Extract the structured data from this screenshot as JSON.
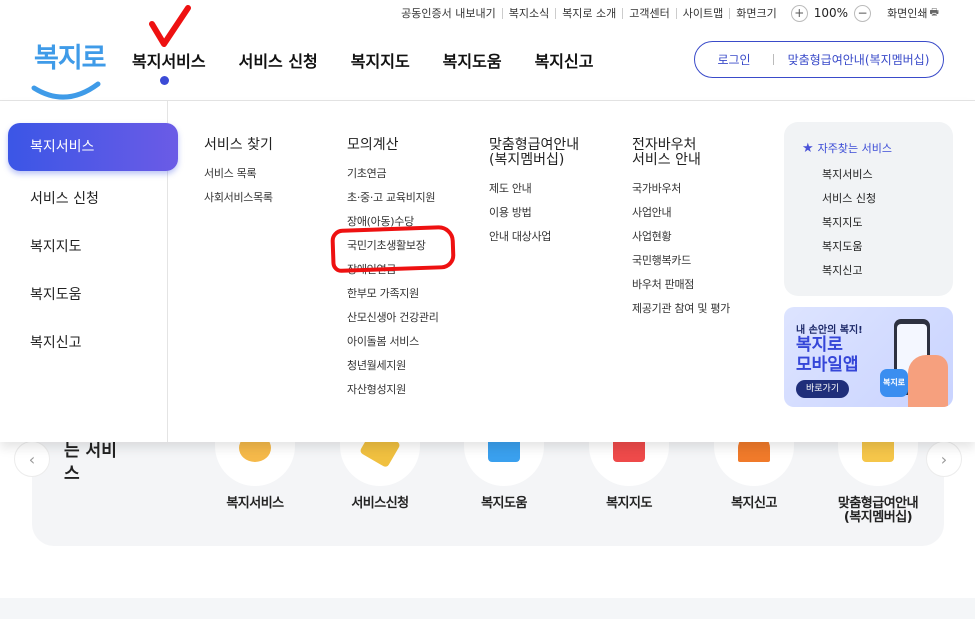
{
  "utility": {
    "links": [
      "공동인증서 내보내기",
      "복지소식",
      "복지로 소개",
      "고객센터",
      "사이트맵",
      "화면크기"
    ],
    "zoom_plus": "+",
    "zoom_value": "100%",
    "zoom_minus": "−",
    "print_label": "화면인쇄"
  },
  "logo": {
    "text": "복지로"
  },
  "gnb": {
    "items": [
      "복지서비스",
      "서비스 신청",
      "복지지도",
      "복지도움",
      "복지신고"
    ]
  },
  "login_box": {
    "login": "로그인",
    "member": "맞춤형급여안내(복지멤버십)"
  },
  "mega": {
    "side": {
      "items": [
        "복지서비스",
        "서비스 신청",
        "복지지도",
        "복지도움",
        "복지신고"
      ]
    },
    "columns": [
      {
        "head": "서비스 찾기",
        "items": [
          "서비스 목록",
          "사회서비스목록"
        ]
      },
      {
        "head": "모의계산",
        "items": [
          "기초연금",
          "초·중·고 교육비지원",
          "장애(아동)수당",
          "국민기초생활보장",
          "장애인연금",
          "한부모 가족지원",
          "산모신생아 건강관리",
          "아이돌봄 서비스",
          "청년월세지원",
          "자산형성지원"
        ]
      },
      {
        "head": "맞춤형급여안내",
        "head2": "(복지멤버십)",
        "items": [
          "제도 안내",
          "이용 방법",
          "안내 대상사업"
        ]
      },
      {
        "head": "전자바우처",
        "head2": "서비스 안내",
        "items": [
          "국가바우처",
          "사업안내",
          "사업현황",
          "국민행복카드",
          "바우처 판매점",
          "제공기관 참여 및 평가"
        ]
      }
    ],
    "favorites": {
      "title": "자주찾는 서비스",
      "items": [
        "복지서비스",
        "서비스 신청",
        "복지지도",
        "복지도움",
        "복지신고"
      ]
    },
    "app_banner": {
      "small": "내 손안의 복지!",
      "big1": "복지로",
      "big2": "모바일앱",
      "button": "바로가기",
      "app_icon": "복지로"
    }
  },
  "background": {
    "section_label_line1": "는 서비",
    "section_label_line2": "스",
    "arrow_left": "‹",
    "arrow_right": "›",
    "services": [
      {
        "label": "복지서비스",
        "color": "#f5b94a"
      },
      {
        "label": "서비스신청",
        "color": "#f0c040"
      },
      {
        "label": "복지도움",
        "color": "#3aa0ee"
      },
      {
        "label": "복지지도",
        "color": "#ee4a4a"
      },
      {
        "label": "복지신고",
        "color": "#f07a2a"
      },
      {
        "label": "맞춤형급여안내",
        "label2": "(복지멤버십)",
        "color": "#f5c64a"
      }
    ]
  },
  "colors": {
    "primary": "#3a4bc9",
    "active_gradient_start": "#3b56e6",
    "annotation": "#ee1111"
  }
}
